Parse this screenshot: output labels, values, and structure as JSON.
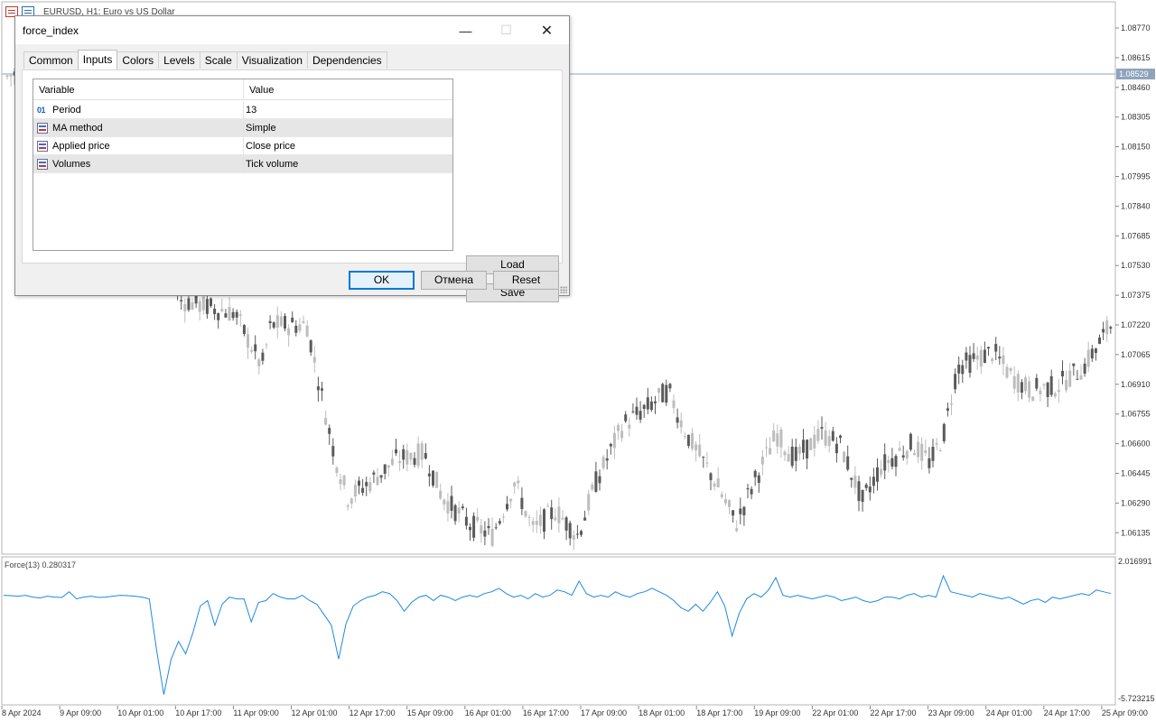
{
  "chart": {
    "title": "EURUSD, H1:  Euro vs US Dollar",
    "price_labels": [
      "1.08770",
      "1.08615",
      "1.08460",
      "1.08305",
      "1.08150",
      "1.07995",
      "1.07840",
      "1.07685",
      "1.07530",
      "1.07375",
      "1.07220",
      "1.07065",
      "1.06910",
      "1.06755",
      "1.06600",
      "1.06445",
      "1.06290",
      "1.06135"
    ],
    "current_price": "1.08529",
    "price_tag_color": "#8fa3bd",
    "bull_color": "#bdbdbd",
    "bear_color": "#5a5a5a",
    "time_labels": [
      "8 Apr 2024",
      "9 Apr 09:00",
      "10 Apr 01:00",
      "10 Apr 17:00",
      "11 Apr 09:00",
      "12 Apr 01:00",
      "12 Apr 17:00",
      "15 Apr 09:00",
      "16 Apr 01:00",
      "16 Apr 17:00",
      "17 Apr 09:00",
      "18 Apr 01:00",
      "18 Apr 17:00",
      "19 Apr 09:00",
      "22 Apr 01:00",
      "22 Apr 17:00",
      "23 Apr 09:00",
      "24 Apr 01:00",
      "24 Apr 17:00",
      "25 Apr 09:00"
    ]
  },
  "indicator": {
    "label": "Force(13) 0.280317",
    "max_label": "2.016991",
    "min_label": "-5.723215",
    "line_color": "#1e88e5"
  },
  "chart_data": {
    "type": "line",
    "title": "Force(13) 0.280317",
    "xlabel": "",
    "ylabel": "",
    "ylim": [
      -5.723215,
      2.016991
    ],
    "series": [
      {
        "values": [
          0.1,
          0.08,
          0.05,
          0.1,
          0.0,
          -0.05,
          0.05,
          0.0,
          -0.02,
          0.3,
          -0.1,
          0.0,
          0.05,
          -0.02,
          0.0,
          0.05,
          0.1,
          0.08,
          0.05,
          0.0,
          -0.1,
          -3.0,
          -5.5,
          -3.5,
          -2.5,
          -3.2,
          -2.0,
          -0.5,
          -0.2,
          -1.6,
          -0.4,
          0.0,
          -0.1,
          -0.1,
          -1.4,
          -0.3,
          -0.2,
          0.2,
          0.0,
          -0.1,
          -0.1,
          0.1,
          -0.2,
          -0.4,
          -1.0,
          -1.6,
          -3.5,
          -1.5,
          -0.5,
          -0.2,
          0.0,
          0.1,
          0.3,
          0.2,
          -0.2,
          -0.8,
          -0.3,
          0.0,
          0.1,
          -0.2,
          0.1,
          0.0,
          -0.2,
          0.0,
          0.1,
          0.0,
          0.2,
          0.3,
          0.5,
          0.2,
          0.0,
          0.1,
          -0.1,
          0.2,
          0.0,
          0.1,
          0.4,
          0.3,
          0.1,
          0.9,
          0.2,
          0.0,
          0.1,
          0.0,
          0.3,
          0.1,
          0.0,
          0.2,
          0.3,
          0.5,
          0.3,
          0.1,
          -0.2,
          -0.6,
          -0.8,
          -0.4,
          -0.8,
          -0.3,
          0.3,
          -0.5,
          -2.2,
          -0.9,
          -0.1,
          0.2,
          0.0,
          0.4,
          1.1,
          0.1,
          0.0,
          0.1,
          0.0,
          -0.1,
          0.0,
          0.1,
          0.0,
          -0.2,
          -0.1,
          0.0,
          -0.2,
          -0.3,
          -0.2,
          0.0,
          0.0,
          -0.1,
          0.1,
          0.2,
          0.0,
          0.1,
          0.0,
          1.2,
          0.3,
          0.2,
          0.1,
          0.0,
          0.2,
          0.1,
          0.0,
          -0.1,
          0.0,
          -0.2,
          -0.4,
          -0.2,
          -0.1,
          -0.3,
          0.0,
          -0.1,
          0.0,
          0.1,
          0.2,
          0.1,
          0.4,
          0.3,
          0.2
        ]
      }
    ]
  },
  "dialog": {
    "title": "force_index",
    "tabs": [
      "Common",
      "Inputs",
      "Colors",
      "Levels",
      "Scale",
      "Visualization",
      "Dependencies"
    ],
    "active_tab": "Inputs",
    "grid": {
      "headers": [
        "Variable",
        "Value"
      ],
      "rows": [
        {
          "icon": "number-icon",
          "icon_text": "01",
          "variable": "Period",
          "value": "13"
        },
        {
          "icon": "enum-icon",
          "variable": "MA method",
          "value": "Simple"
        },
        {
          "icon": "enum-icon",
          "variable": "Applied price",
          "value": "Close price"
        },
        {
          "icon": "enum-icon",
          "variable": "Volumes",
          "value": "Tick volume"
        }
      ]
    },
    "load_label": "Load",
    "save_label": "Save",
    "ok_label": "OK",
    "cancel_label": "Отмена",
    "reset_label": "Reset"
  }
}
